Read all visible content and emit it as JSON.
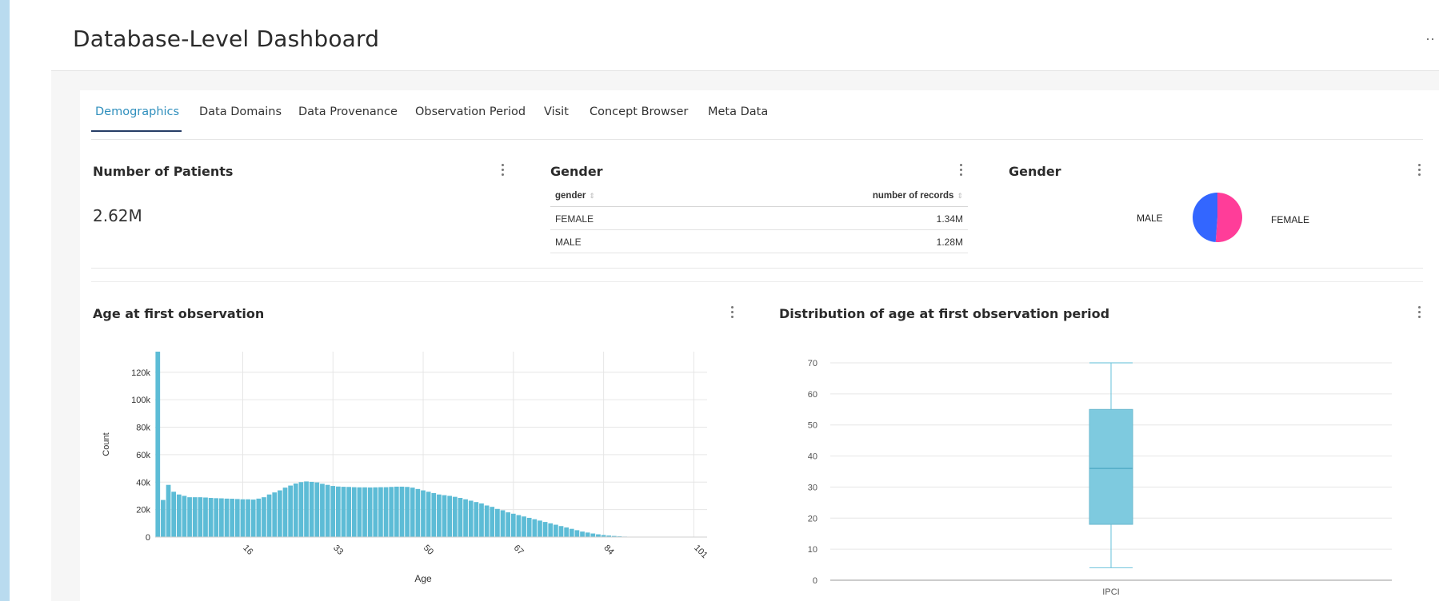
{
  "header": {
    "title": "Database-Level Dashboard",
    "menu_icon": "ellipsis-icon",
    "menu_glyph": "··"
  },
  "tabs": [
    {
      "label": "Demographics",
      "active": true
    },
    {
      "label": "Data Domains",
      "active": false
    },
    {
      "label": "Data Provenance",
      "active": false
    },
    {
      "label": "Observation Period",
      "active": false
    },
    {
      "label": "Visit",
      "active": false
    },
    {
      "label": "Concept Browser",
      "active": false
    },
    {
      "label": "Meta Data",
      "active": false
    }
  ],
  "cards": {
    "patients": {
      "title": "Number of Patients",
      "value": "2.62M"
    },
    "gender_table": {
      "title": "Gender",
      "columns": [
        "gender",
        "number of records"
      ],
      "rows": [
        {
          "gender": "FEMALE",
          "records": "1.34M"
        },
        {
          "gender": "MALE",
          "records": "1.28M"
        }
      ]
    },
    "gender_pie": {
      "title": "Gender",
      "labels": {
        "male": "MALE",
        "female": "FEMALE"
      }
    },
    "age_hist": {
      "title": "Age at first observation"
    },
    "age_box": {
      "title": "Distribution of age at first observation period"
    }
  },
  "colors": {
    "accent": "#2f8fbd",
    "bar": "#5dbcd6",
    "male": "#3366ff",
    "female": "#ff3d99",
    "box": "#7ecadf",
    "tab_underline": "#263d66"
  },
  "chart_data": [
    {
      "type": "bar",
      "title": "Age at first observation",
      "xlabel": "Age",
      "ylabel": "Count",
      "xticks": [
        "16",
        "33",
        "50",
        "67",
        "84",
        "101"
      ],
      "yticks": [
        "0",
        "20k",
        "40k",
        "60k",
        "80k",
        "100k",
        "120k"
      ],
      "ylim": [
        0,
        135000
      ],
      "grid": true,
      "x_start": 0,
      "values": [
        135000,
        27000,
        38000,
        33000,
        31000,
        30000,
        29000,
        29000,
        29000,
        28800,
        28500,
        28300,
        28200,
        28000,
        27900,
        27700,
        27500,
        27500,
        27300,
        28000,
        29000,
        31000,
        32500,
        34000,
        36000,
        37500,
        39000,
        40000,
        40500,
        40200,
        39800,
        38800,
        38000,
        37200,
        36800,
        36600,
        36500,
        36300,
        36200,
        36200,
        36100,
        36200,
        36300,
        36300,
        36500,
        36700,
        36700,
        36500,
        36000,
        35000,
        34000,
        33000,
        32000,
        31000,
        30500,
        30000,
        29300,
        28500,
        27500,
        26500,
        25500,
        24500,
        23000,
        22000,
        20500,
        19500,
        18000,
        17000,
        16000,
        15000,
        14000,
        13000,
        12000,
        11000,
        10000,
        9000,
        8000,
        7000,
        6000,
        5000,
        4000,
        3300,
        2600,
        2000,
        1500,
        1100,
        800,
        550,
        350,
        220,
        130,
        70,
        40,
        20,
        10
      ],
      "series_color": "#5dbcd6"
    },
    {
      "type": "box",
      "title": "Distribution of age at first observation period",
      "category": "IPCI",
      "yticks": [
        "0",
        "10",
        "20",
        "30",
        "40",
        "50",
        "60",
        "70"
      ],
      "ylim": [
        0,
        70
      ],
      "grid": true,
      "min": 4,
      "q1": 18,
      "median": 36,
      "q3": 55,
      "max": 70
    },
    {
      "type": "pie",
      "title": "Gender",
      "labels": [
        "MALE",
        "FEMALE"
      ],
      "values": [
        1.28,
        1.34
      ]
    }
  ]
}
